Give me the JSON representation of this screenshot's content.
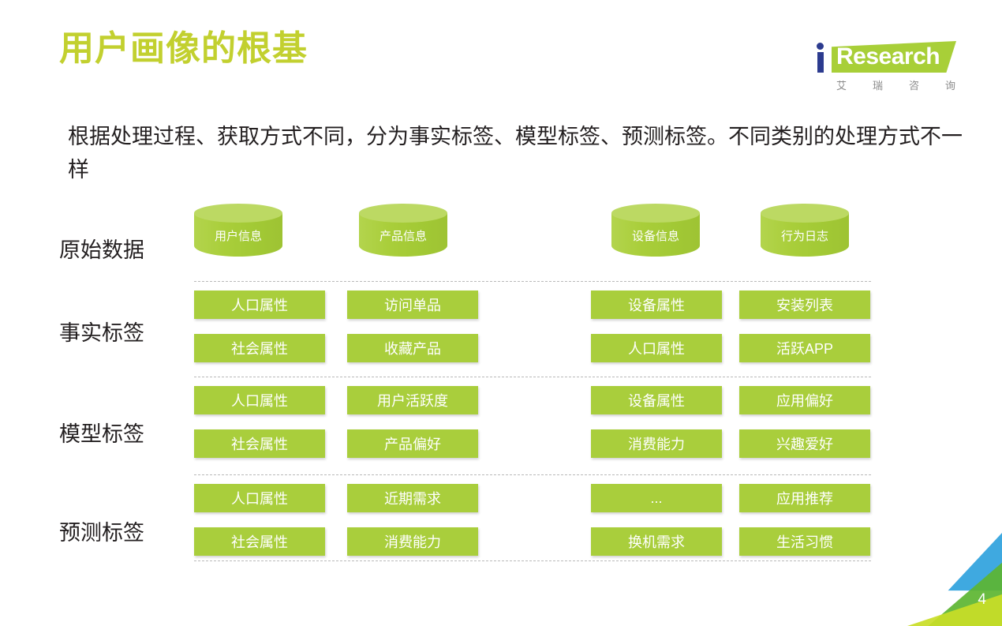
{
  "slide": {
    "title": "用户画像的根基",
    "subtitle": "根据处理过程、获取方式不同，分为事实标签、模型标签、预测标签。不同类别的处理方式不一样",
    "page_number": "4",
    "title_color": "#c2d02f",
    "accent_color": "#a9ce3c"
  },
  "logo": {
    "initial": "i",
    "word": "Research",
    "sub_chars": [
      "艾",
      "瑞",
      "咨",
      "询"
    ]
  },
  "diagram": {
    "row_labels": [
      {
        "label": "原始数据"
      },
      {
        "label": "事实标签"
      },
      {
        "label": "模型标签"
      },
      {
        "label": "预测标签"
      }
    ],
    "sources": [
      {
        "label": "用户信息"
      },
      {
        "label": "产品信息"
      },
      {
        "label": "设备信息"
      },
      {
        "label": "行为日志"
      }
    ],
    "fact_tags": [
      {
        "label": "人口属性"
      },
      {
        "label": "访问单品"
      },
      {
        "label": "设备属性"
      },
      {
        "label": "安装列表"
      },
      {
        "label": "社会属性"
      },
      {
        "label": "收藏产品"
      },
      {
        "label": "人口属性"
      },
      {
        "label": "活跃APP"
      }
    ],
    "model_tags": [
      {
        "label": "人口属性"
      },
      {
        "label": "用户活跃度"
      },
      {
        "label": "设备属性"
      },
      {
        "label": "应用偏好"
      },
      {
        "label": "社会属性"
      },
      {
        "label": "产品偏好"
      },
      {
        "label": "消费能力"
      },
      {
        "label": "兴趣爱好"
      }
    ],
    "predict_tags": [
      {
        "label": "人口属性"
      },
      {
        "label": "近期需求"
      },
      {
        "label": "..."
      },
      {
        "label": "应用推荐"
      },
      {
        "label": "社会属性"
      },
      {
        "label": "消费能力"
      },
      {
        "label": "换机需求"
      },
      {
        "label": "生活习惯"
      }
    ]
  }
}
